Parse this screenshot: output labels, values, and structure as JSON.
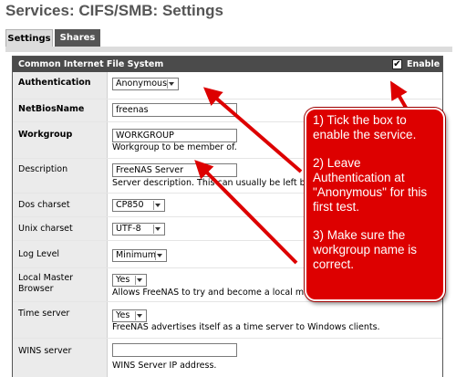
{
  "page": {
    "title": "Services: CIFS/SMB: Settings"
  },
  "tabs": [
    {
      "label": "Settings",
      "active": true
    },
    {
      "label": "Shares",
      "active": false
    }
  ],
  "panel": {
    "header_title": "Common Internet File System",
    "enable_label": "Enable",
    "enable_checked": true,
    "enable_mark": "✔"
  },
  "form": {
    "authentication": {
      "label": "Authentication",
      "value": "Anonymous"
    },
    "netbiosname": {
      "label": "NetBiosName",
      "value": "freenas"
    },
    "workgroup": {
      "label": "Workgroup",
      "value": "WORKGROUP",
      "description": "Workgroup to be member of."
    },
    "description": {
      "label": "Description",
      "value": "FreeNAS Server",
      "description": "Server description. This can usually be left blank."
    },
    "dos_charset": {
      "label": "Dos charset",
      "value": "CP850"
    },
    "unix_charset": {
      "label": "Unix charset",
      "value": "UTF-8"
    },
    "log_level": {
      "label": "Log Level",
      "value": "Minimum"
    },
    "local_master": {
      "label": "Local Master Browser",
      "value": "Yes",
      "description": "Allows FreeNAS to try and become a local master browser."
    },
    "time_server": {
      "label": "Time server",
      "value": "Yes",
      "description": "FreeNAS advertises itself as a time server to Windows clients."
    },
    "wins_server": {
      "label": "WINS server",
      "value": "",
      "description": "WINS Server IP address."
    }
  },
  "callout": {
    "line1": "1) Tick the box to enable the service.",
    "line2": "2) Leave Authentication at \"Anonymous\" for this first test.",
    "line3": "3) Make sure the workgroup name is correct.",
    "color": "#dd0000"
  }
}
